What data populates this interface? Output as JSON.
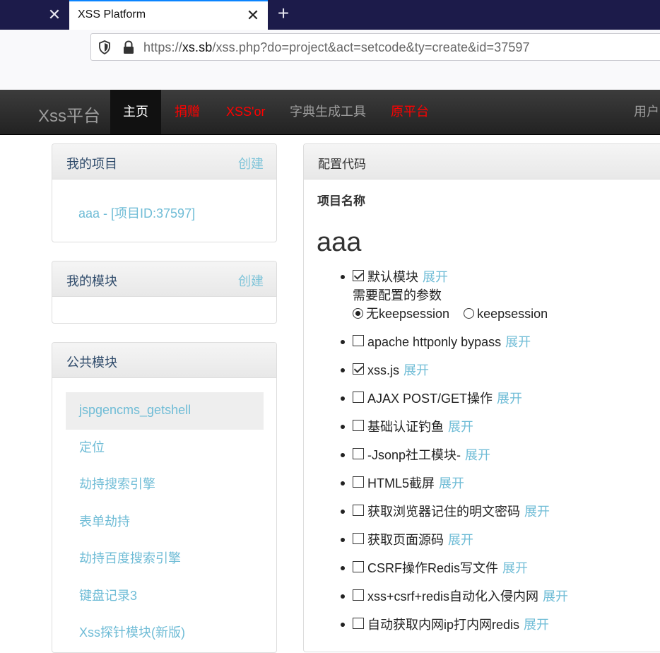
{
  "browser": {
    "tab_title": "XSS Platform",
    "close_symbol": "✕",
    "new_tab_symbol": "+",
    "url_host": "xs.sb",
    "url_prefix": "https://",
    "url_path": "/xss.php?do=project&act=setcode&ty=create&id=37597"
  },
  "nav": {
    "brand": "Xss平台",
    "home": "主页",
    "donate": "捐赠",
    "xssor": "XSS'or",
    "dict": "字典生成工具",
    "original": "原平台",
    "user": "用户"
  },
  "my_projects": {
    "title": "我的项目",
    "action": "创建",
    "item": "aaa - [项目ID:37597]"
  },
  "my_modules": {
    "title": "我的模块",
    "action": "创建"
  },
  "public_modules": {
    "title": "公共模块",
    "items": [
      "jspgencms_getshell",
      "定位",
      "劫持搜索引擎",
      "表单劫持",
      "劫持百度搜索引擎",
      "键盘记录3",
      "Xss探针模块(新版)"
    ]
  },
  "config": {
    "title": "配置代码",
    "project_label": "项目名称",
    "project_name": "aaa",
    "expand_label": "展开",
    "params_label": "需要配置的参数",
    "radio_options": [
      "无keepsession",
      "keepsession"
    ],
    "modules": [
      {
        "name": "默认模块",
        "checked": true
      },
      {
        "name": "apache httponly bypass",
        "checked": false
      },
      {
        "name": "xss.js",
        "checked": true
      },
      {
        "name": "AJAX POST/GET操作",
        "checked": false
      },
      {
        "name": "基础认证钓鱼",
        "checked": false
      },
      {
        "name": "-Jsonp社工模块-",
        "checked": false
      },
      {
        "name": "HTML5截屏",
        "checked": false
      },
      {
        "name": "获取浏览器记住的明文密码",
        "checked": false
      },
      {
        "name": "获取页面源码",
        "checked": false
      },
      {
        "name": "CSRF操作Redis写文件",
        "checked": false
      },
      {
        "name": "xss+csrf+redis自动化入侵内网",
        "checked": false
      },
      {
        "name": "自动获取内网ip打内网redis",
        "checked": false
      }
    ]
  }
}
